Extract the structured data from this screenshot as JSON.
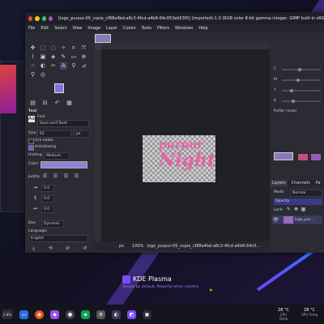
{
  "window": {
    "title": "[logo_purpur-09_copia_cf88a4bd-a8c3-4fcd-a4b8-64c053eb53f0] (imported)-1.0 (RGB color 8-bit gamma integer, GIMP built-in sRGB, 1 layer) 600x...",
    "controls": [
      "#e74c3c",
      "#f1c40f",
      "#2ecc71",
      "#9b59b6"
    ]
  },
  "menu": [
    "File",
    "Edit",
    "Select",
    "View",
    "Image",
    "Layer",
    "Colors",
    "Tools",
    "Filters",
    "Windows",
    "Help"
  ],
  "text_tool": {
    "heading": "Text",
    "font_label": "Font",
    "font_value": "Sans-serif Bold",
    "size_label": "Size:",
    "size_value": "62",
    "size_unit": "px",
    "use_editor": "Use editor",
    "antialiasing": "Antialiasing",
    "hinting_label": "Hinting:",
    "hinting_value": "Medium",
    "color_label": "Color:",
    "justify_label": "Justify:",
    "indent_value": "0.0",
    "line_spacing_value": "0.0",
    "letter_spacing_value": "0.0",
    "box_label": "Box:",
    "box_value": "Dynamic",
    "language_label": "Language:",
    "language_value": "English"
  },
  "canvas": {
    "logo_line1": "purpur",
    "logo_line2": "Night"
  },
  "statusbar": {
    "unit": "px",
    "zoom": "100%",
    "filename": "logo_purpur-09_copia_cf88a4bd-a8c3-4fcd-a4b8-64c0..."
  },
  "right_dock": {
    "slider_labels": [
      "C",
      "M",
      "Y",
      "K"
    ],
    "profile": "Profile: (none)",
    "tabs": [
      "Layers",
      "Channels",
      "Pa"
    ],
    "mode_label": "Mode",
    "mode_value": "Normal",
    "opacity_label": "Opacity",
    "lock_label": "Lock:",
    "layer_name": "logo_pur..."
  },
  "plasma": {
    "name": "KDE Plasma",
    "tagline": "Simple by default, Powerful when needed."
  },
  "taskbar": {
    "left_badge": "2.8%",
    "sensors": [
      {
        "value": "28 °C",
        "label": "CPU Temp"
      },
      {
        "value": "28 °C",
        "label": "GPU Temp"
      }
    ]
  }
}
